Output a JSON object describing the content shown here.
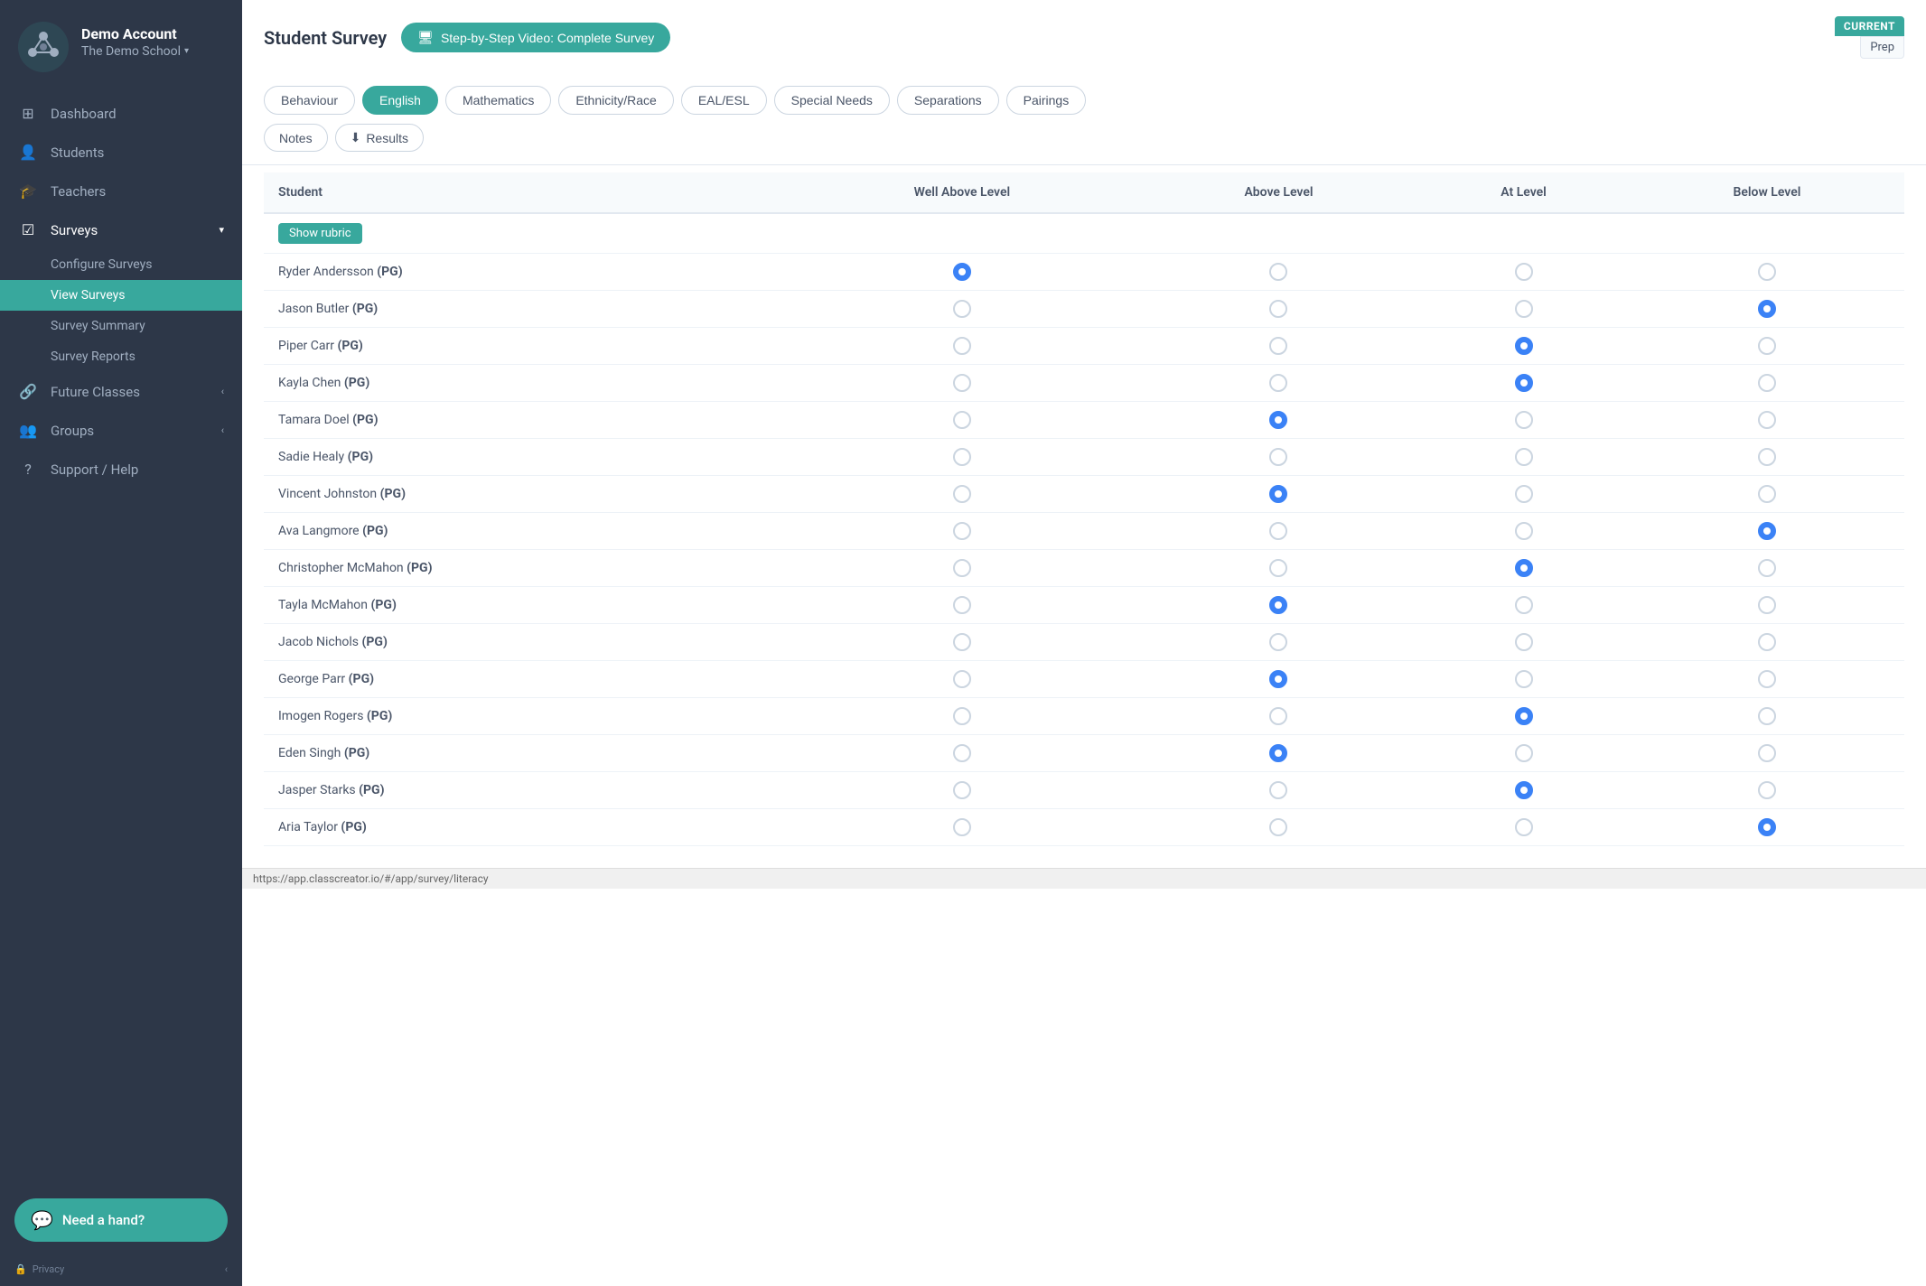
{
  "sidebar": {
    "account_name": "Demo Account",
    "school_name": "The Demo School",
    "nav_items": [
      {
        "id": "dashboard",
        "label": "Dashboard",
        "icon": "⊞",
        "has_arrow": false
      },
      {
        "id": "students",
        "label": "Students",
        "icon": "👤",
        "has_arrow": false
      },
      {
        "id": "teachers",
        "label": "Teachers",
        "icon": "🎓",
        "has_arrow": false
      },
      {
        "id": "surveys",
        "label": "Surveys",
        "icon": "☑",
        "has_arrow": true,
        "active": true
      },
      {
        "id": "future-classes",
        "label": "Future Classes",
        "icon": "🔗",
        "has_arrow": true
      },
      {
        "id": "groups",
        "label": "Groups",
        "icon": "👥",
        "has_arrow": true
      },
      {
        "id": "support",
        "label": "Support / Help",
        "icon": "?",
        "has_arrow": false
      }
    ],
    "sub_items": [
      {
        "id": "configure-surveys",
        "label": "Configure Surveys"
      },
      {
        "id": "view-surveys",
        "label": "View Surveys",
        "active": true
      },
      {
        "id": "survey-summary",
        "label": "Survey Summary"
      },
      {
        "id": "survey-reports",
        "label": "Survey Reports"
      }
    ],
    "need_hand_label": "Need a hand?"
  },
  "header": {
    "page_title": "Student Survey",
    "video_btn_label": "Step-by-Step Video: Complete Survey",
    "current_badge": "CURRENT",
    "current_sub": "Prep"
  },
  "tabs": [
    {
      "id": "behaviour",
      "label": "Behaviour"
    },
    {
      "id": "english",
      "label": "English",
      "active": true
    },
    {
      "id": "mathematics",
      "label": "Mathematics"
    },
    {
      "id": "ethnicity",
      "label": "Ethnicity/Race"
    },
    {
      "id": "eal",
      "label": "EAL/ESL"
    },
    {
      "id": "special-needs",
      "label": "Special Needs"
    },
    {
      "id": "separations",
      "label": "Separations"
    },
    {
      "id": "pairings",
      "label": "Pairings"
    }
  ],
  "sub_tabs": [
    {
      "id": "notes",
      "label": "Notes"
    },
    {
      "id": "results",
      "label": "Results",
      "icon": "⬇"
    }
  ],
  "table": {
    "columns": [
      "Student",
      "Well Above Level",
      "Above Level",
      "At Level",
      "Below Level"
    ],
    "show_rubric_label": "Show rubric",
    "rows": [
      {
        "name": "Ryder Andersson",
        "group": "PG",
        "selected": 0
      },
      {
        "name": "Jason Butler",
        "group": "PG",
        "selected": 3
      },
      {
        "name": "Piper Carr",
        "group": "PG",
        "selected": 2
      },
      {
        "name": "Kayla Chen",
        "group": "PG",
        "selected": 2
      },
      {
        "name": "Tamara Doel",
        "group": "PG",
        "selected": 1
      },
      {
        "name": "Sadie Healy",
        "group": "PG",
        "selected": -1
      },
      {
        "name": "Vincent Johnston",
        "group": "PG",
        "selected": 1
      },
      {
        "name": "Ava Langmore",
        "group": "PG",
        "selected": 3
      },
      {
        "name": "Christopher McMahon",
        "group": "PG",
        "selected": 2
      },
      {
        "name": "Tayla McMahon",
        "group": "PG",
        "selected": 1
      },
      {
        "name": "Jacob Nichols",
        "group": "PG",
        "selected": -1
      },
      {
        "name": "George Parr",
        "group": "PG",
        "selected": 1
      },
      {
        "name": "Imogen Rogers",
        "group": "PG",
        "selected": 2
      },
      {
        "name": "Eden Singh",
        "group": "PG",
        "selected": 1
      },
      {
        "name": "Jasper Starks",
        "group": "PG",
        "selected": 2
      },
      {
        "name": "Aria Taylor",
        "group": "PG",
        "selected": 3
      }
    ]
  },
  "url": "https://app.classcreator.io/#/app/survey/literacy"
}
